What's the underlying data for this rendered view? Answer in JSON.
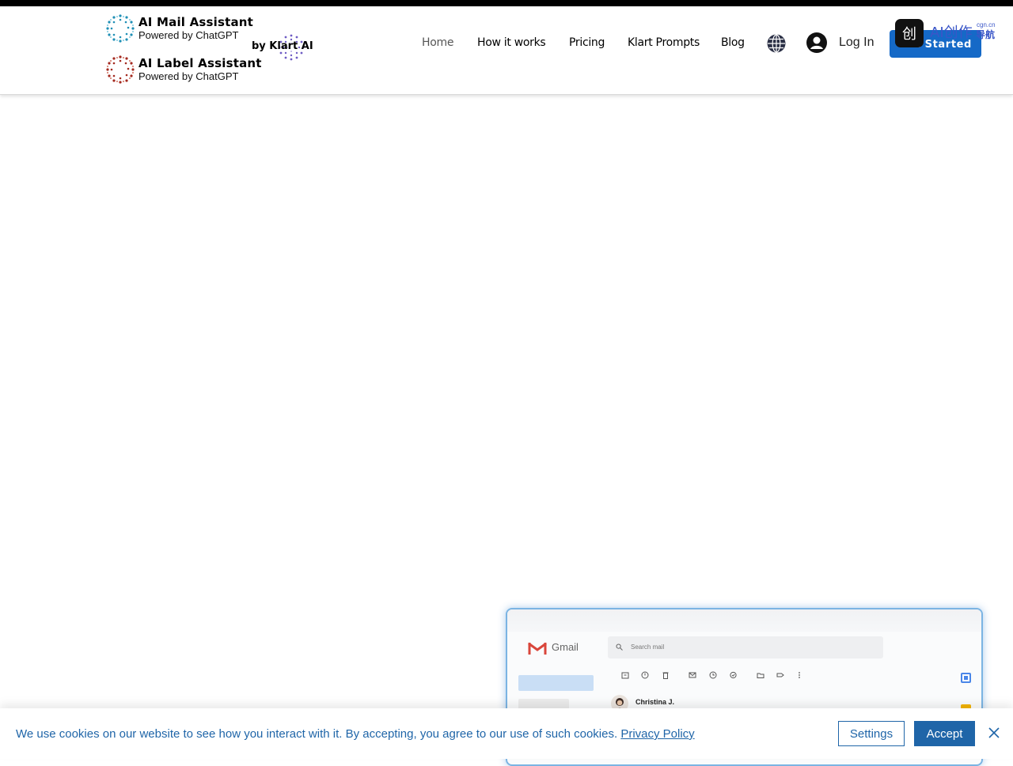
{
  "header": {
    "brand1": {
      "title": "AI Mail Assistant",
      "subtitle": "Powered by ChatGPT"
    },
    "brand2": {
      "title": "AI Label Assistant",
      "subtitle": "Powered by ChatGPT"
    },
    "by_label": "by Klart AI",
    "nav": [
      {
        "label": "Home",
        "active": true
      },
      {
        "label": "How it works"
      },
      {
        "label": "Pricing"
      },
      {
        "label": "Klart Prompts"
      },
      {
        "label": "Blog"
      }
    ],
    "language_icon": "globe-icon",
    "login_label": "Log In",
    "cta_label": "Get Started",
    "watermark": {
      "icon_text": "创",
      "text": "AI创作",
      "small": "cgn.cn",
      "suffix": "导航"
    }
  },
  "mockup": {
    "app_name": "Gmail",
    "search_placeholder": "Search mail",
    "sender_name": "Christina J."
  },
  "cookie": {
    "message": "We use cookies on our website to see how you interact with it. By accepting, you agree to our use of such cookies.",
    "privacy_link": "Privacy Policy",
    "settings_label": "Settings",
    "accept_label": "Accept"
  },
  "colors": {
    "accent": "#1569c7",
    "cookie_text": "#1f65a8",
    "brand1_dots": "#1e8fb5",
    "brand2_dots": "#a3291f",
    "klart_dots": "#6e5bc4"
  }
}
